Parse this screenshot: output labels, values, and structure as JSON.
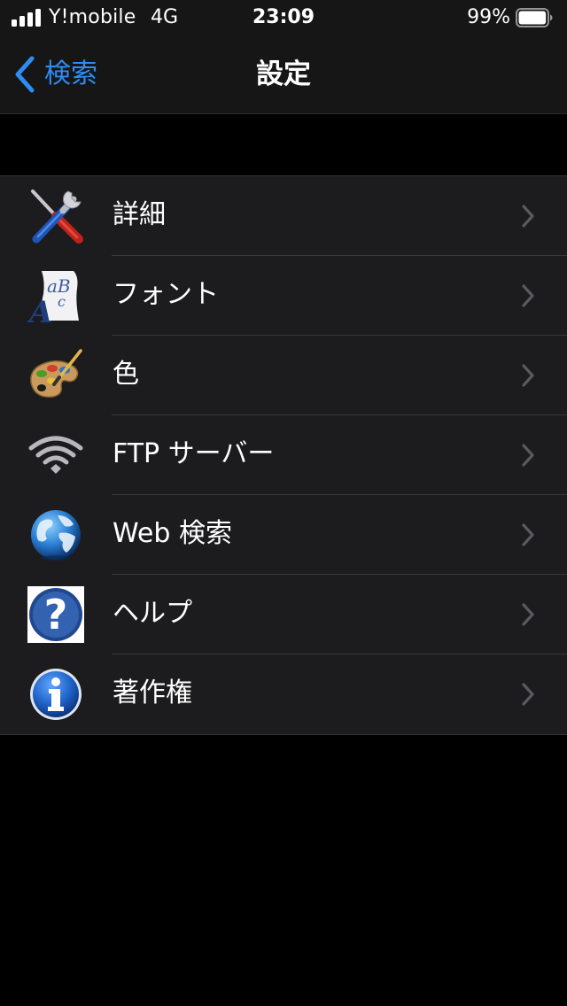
{
  "status_bar": {
    "carrier": "Y!mobile",
    "network": "4G",
    "time": "23:09",
    "battery_percent": "99%",
    "battery_level": 0.99,
    "signal_bars": 4
  },
  "nav": {
    "back_label": "検索",
    "title": "設定"
  },
  "colors": {
    "accent": "#2e8cf5",
    "background": "#000000",
    "cell_background": "#1c1c1e",
    "bar_background": "#161616",
    "chevron": "#5a5a5e"
  },
  "settings_items": [
    {
      "id": "details",
      "label": "詳細",
      "icon": "tools-icon"
    },
    {
      "id": "font",
      "label": "フォント",
      "icon": "font-icon"
    },
    {
      "id": "color",
      "label": "色",
      "icon": "palette-icon"
    },
    {
      "id": "ftp",
      "label": "FTP サーバー",
      "icon": "wifi-icon"
    },
    {
      "id": "web-search",
      "label": "Web 検索",
      "icon": "globe-icon"
    },
    {
      "id": "help",
      "label": "ヘルプ",
      "icon": "help-icon"
    },
    {
      "id": "copyright",
      "label": "著作権",
      "icon": "info-icon"
    }
  ]
}
